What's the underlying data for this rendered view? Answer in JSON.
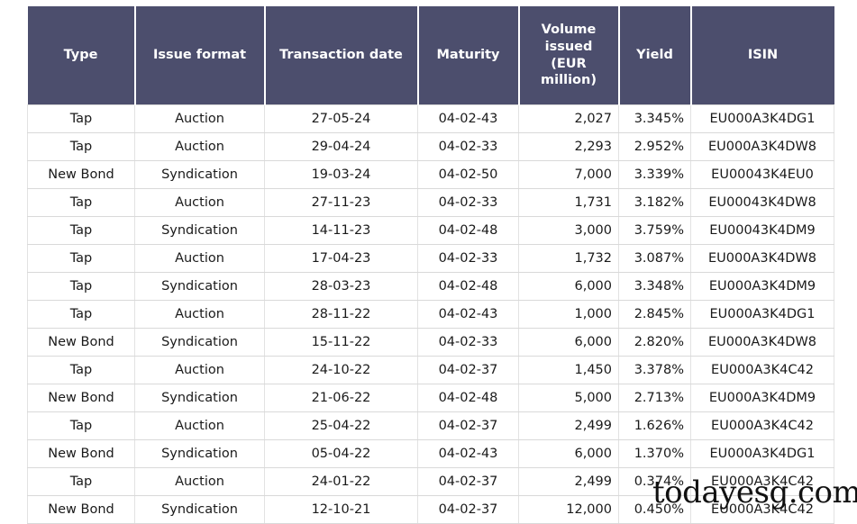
{
  "table": {
    "columns": [
      {
        "key": "type",
        "label": "Type"
      },
      {
        "key": "format",
        "label": "Issue format"
      },
      {
        "key": "txdate",
        "label": "Transaction date"
      },
      {
        "key": "maturity",
        "label": "Maturity"
      },
      {
        "key": "volume",
        "label": "Volume issued (EUR million)"
      },
      {
        "key": "yield",
        "label": "Yield"
      },
      {
        "key": "isin",
        "label": "ISIN"
      }
    ],
    "header_lines": {
      "type": [
        "Type"
      ],
      "format": [
        "Issue format"
      ],
      "txdate": [
        "Transaction date"
      ],
      "maturity": [
        "Maturity"
      ],
      "volume": [
        "Volume",
        "issued",
        "(EUR",
        "million)"
      ],
      "yield": [
        "Yield"
      ],
      "isin": [
        "ISIN"
      ]
    },
    "rows": [
      {
        "type": "Tap",
        "format": "Auction",
        "txdate": "27-05-24",
        "maturity": "04-02-43",
        "volume": "2,027",
        "yield": "3.345%",
        "isin": "EU000A3K4DG1"
      },
      {
        "type": "Tap",
        "format": "Auction",
        "txdate": "29-04-24",
        "maturity": "04-02-33",
        "volume": "2,293",
        "yield": "2.952%",
        "isin": "EU000A3K4DW8"
      },
      {
        "type": "New Bond",
        "format": "Syndication",
        "txdate": "19-03-24",
        "maturity": "04-02-50",
        "volume": "7,000",
        "yield": "3.339%",
        "isin": "EU00043K4EU0"
      },
      {
        "type": "Tap",
        "format": "Auction",
        "txdate": "27-11-23",
        "maturity": "04-02-33",
        "volume": "1,731",
        "yield": "3.182%",
        "isin": "EU00043K4DW8"
      },
      {
        "type": "Tap",
        "format": "Syndication",
        "txdate": "14-11-23",
        "maturity": "04-02-48",
        "volume": "3,000",
        "yield": "3.759%",
        "isin": "EU00043K4DM9"
      },
      {
        "type": "Tap",
        "format": "Auction",
        "txdate": "17-04-23",
        "maturity": "04-02-33",
        "volume": "1,732",
        "yield": "3.087%",
        "isin": "EU000A3K4DW8"
      },
      {
        "type": "Tap",
        "format": "Syndication",
        "txdate": "28-03-23",
        "maturity": "04-02-48",
        "volume": "6,000",
        "yield": "3.348%",
        "isin": "EU000A3K4DM9"
      },
      {
        "type": "Tap",
        "format": "Auction",
        "txdate": "28-11-22",
        "maturity": "04-02-43",
        "volume": "1,000",
        "yield": "2.845%",
        "isin": "EU000A3K4DG1"
      },
      {
        "type": "New Bond",
        "format": "Syndication",
        "txdate": "15-11-22",
        "maturity": "04-02-33",
        "volume": "6,000",
        "yield": "2.820%",
        "isin": "EU000A3K4DW8"
      },
      {
        "type": "Tap",
        "format": "Auction",
        "txdate": "24-10-22",
        "maturity": "04-02-37",
        "volume": "1,450",
        "yield": "3.378%",
        "isin": "EU000A3K4C42"
      },
      {
        "type": "New Bond",
        "format": "Syndication",
        "txdate": "21-06-22",
        "maturity": "04-02-48",
        "volume": "5,000",
        "yield": "2.713%",
        "isin": "EU000A3K4DM9"
      },
      {
        "type": "Tap",
        "format": "Auction",
        "txdate": "25-04-22",
        "maturity": "04-02-37",
        "volume": "2,499",
        "yield": "1.626%",
        "isin": "EU000A3K4C42"
      },
      {
        "type": "New Bond",
        "format": "Syndication",
        "txdate": "05-04-22",
        "maturity": "04-02-43",
        "volume": "6,000",
        "yield": "1.370%",
        "isin": "EU000A3K4DG1"
      },
      {
        "type": "Tap",
        "format": "Auction",
        "txdate": "24-01-22",
        "maturity": "04-02-37",
        "volume": "2,499",
        "yield": "0.374%",
        "isin": "EU000A3K4C42"
      },
      {
        "type": "New Bond",
        "format": "Syndication",
        "txdate": "12-10-21",
        "maturity": "04-02-37",
        "volume": "12,000",
        "yield": "0.450%",
        "isin": "EU000A3K4C42"
      }
    ]
  },
  "watermark": {
    "text": "todayesg.com"
  },
  "colors": {
    "header_background": "#4c4e6d",
    "header_text": "#ffffff",
    "body_text": "#1a1a1a",
    "row_border": "#d9d9d9",
    "page_background": "#ffffff"
  }
}
